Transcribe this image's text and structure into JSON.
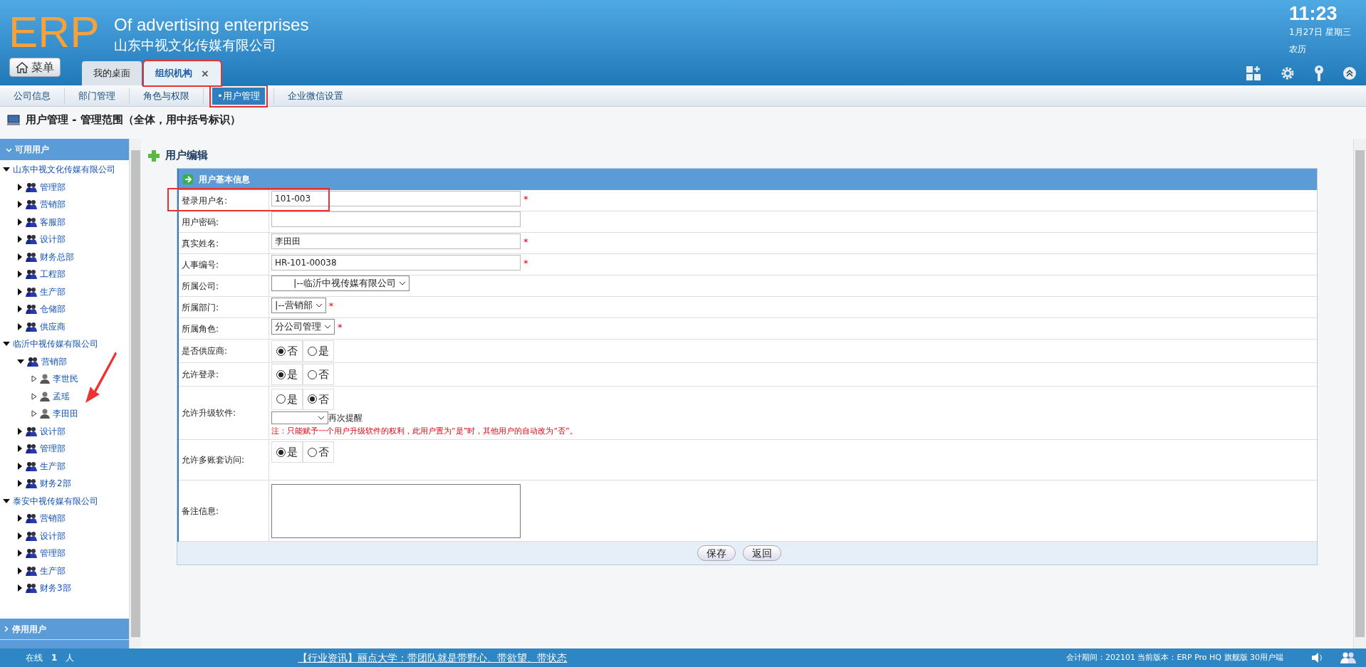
{
  "header": {
    "logo": "ERP",
    "slogan": "Of advertising enterprises",
    "company": "山东中视文化传媒有限公司",
    "time": "11:23",
    "date": "1月27日 星期三",
    "lunar": "农历",
    "menu_button": "菜单"
  },
  "tabs": [
    {
      "label": "我的桌面",
      "selected": false,
      "closable": false,
      "highlighted": false
    },
    {
      "label": "组织机构",
      "selected": true,
      "closable": true,
      "highlighted": true
    }
  ],
  "close_glyph": "×",
  "subnav": [
    {
      "label": "公司信息",
      "selected": false
    },
    {
      "label": "部门管理",
      "selected": false
    },
    {
      "label": "角色与权限",
      "selected": false
    },
    {
      "label": "•用户管理",
      "selected": true
    },
    {
      "label": "企业微信设置",
      "selected": false
    }
  ],
  "page_title": "用户管理 - 管理范围（全体，用中括号标识）",
  "sidebar": {
    "sections": [
      {
        "label": "可用用户",
        "expanded": true
      },
      {
        "label": "停用用户",
        "expanded": false
      }
    ],
    "tree": [
      {
        "label": "山东中视文化传媒有限公司",
        "kind": "company",
        "expanded": true,
        "children": [
          {
            "label": "管理部",
            "kind": "dept",
            "expanded": false
          },
          {
            "label": "营销部",
            "kind": "dept",
            "expanded": false
          },
          {
            "label": "客服部",
            "kind": "dept",
            "expanded": false
          },
          {
            "label": "设计部",
            "kind": "dept",
            "expanded": false
          },
          {
            "label": "财务总部",
            "kind": "dept",
            "expanded": false
          },
          {
            "label": "工程部",
            "kind": "dept",
            "expanded": false
          },
          {
            "label": "生产部",
            "kind": "dept",
            "expanded": false
          },
          {
            "label": "仓储部",
            "kind": "dept",
            "expanded": false
          },
          {
            "label": "供应商",
            "kind": "dept",
            "expanded": false
          }
        ]
      },
      {
        "label": "临沂中视传媒有限公司",
        "kind": "company",
        "expanded": true,
        "children": [
          {
            "label": "营销部",
            "kind": "dept",
            "expanded": true,
            "children": [
              {
                "label": "李世民",
                "kind": "person",
                "expanded": false
              },
              {
                "label": "孟瑶",
                "kind": "person",
                "expanded": false
              },
              {
                "label": "李田田",
                "kind": "person",
                "expanded": false
              }
            ]
          },
          {
            "label": "设计部",
            "kind": "dept",
            "expanded": false
          },
          {
            "label": "管理部",
            "kind": "dept",
            "expanded": false
          },
          {
            "label": "生产部",
            "kind": "dept",
            "expanded": false
          },
          {
            "label": "财务2部",
            "kind": "dept",
            "expanded": false
          }
        ]
      },
      {
        "label": "泰安中视传媒有限公司",
        "kind": "company",
        "expanded": true,
        "children": [
          {
            "label": "营销部",
            "kind": "dept",
            "expanded": false
          },
          {
            "label": "设计部",
            "kind": "dept",
            "expanded": false
          },
          {
            "label": "管理部",
            "kind": "dept",
            "expanded": false
          },
          {
            "label": "生产部",
            "kind": "dept",
            "expanded": false
          },
          {
            "label": "财务3部",
            "kind": "dept",
            "expanded": false
          }
        ]
      }
    ]
  },
  "form": {
    "title": "用户编辑",
    "section": "用户基本信息",
    "required_mark": "*",
    "rows": [
      {
        "kind": "text",
        "label": "登录用户名:",
        "value": "101-003",
        "required": true,
        "highlighted": true
      },
      {
        "kind": "text",
        "label": "用户密码:",
        "value": "",
        "required": false,
        "highlighted": false
      },
      {
        "kind": "text",
        "label": "真实姓名:",
        "value": "李田田",
        "required": true,
        "highlighted": false
      },
      {
        "kind": "text",
        "label": "人事编号:",
        "value": "HR-101-00038",
        "required": true,
        "highlighted": false
      },
      {
        "kind": "select",
        "label": "所属公司:",
        "value": "　　|--临沂中视传媒有限公司",
        "required": false,
        "highlighted": false
      },
      {
        "kind": "select",
        "label": "所属部门:",
        "value": "|--营销部",
        "required": true,
        "highlighted": false
      },
      {
        "kind": "select",
        "label": "所属角色:",
        "value": "分公司管理",
        "required": true,
        "highlighted": false
      },
      {
        "kind": "radio",
        "label": "是否供应商:",
        "options": [
          {
            "label": "否",
            "selected": true
          },
          {
            "label": "是",
            "selected": false
          }
        ]
      },
      {
        "kind": "radio",
        "label": "允许登录:",
        "options": [
          {
            "label": "是",
            "selected": true
          },
          {
            "label": "否",
            "selected": false
          }
        ]
      },
      {
        "kind": "upgrade",
        "label": "允许升级软件:",
        "options": [
          {
            "label": "是",
            "selected": false
          },
          {
            "label": "否",
            "selected": true
          }
        ],
        "remind": "再次提醒",
        "note": "注：只能赋予一个用户升级软件的权利，此用户置为“是”时，其他用户的自动改为“否”。"
      },
      {
        "kind": "radio_tall",
        "label": "允许多账套访问:",
        "options": [
          {
            "label": "是",
            "selected": true
          },
          {
            "label": "否",
            "selected": false
          }
        ]
      },
      {
        "kind": "textarea",
        "label": "备注信息:",
        "value": ""
      }
    ],
    "buttons": [
      "保存",
      "返回"
    ]
  },
  "status_bar": {
    "online": "在线",
    "online_count": "1",
    "online_unit": "人",
    "news": "【行业资讯】丽点大学：带团队就是带野心、带欲望、带状态",
    "info": "会计期间：202101 当前版本：ERP Pro HQ 旗舰版 30用户端"
  }
}
